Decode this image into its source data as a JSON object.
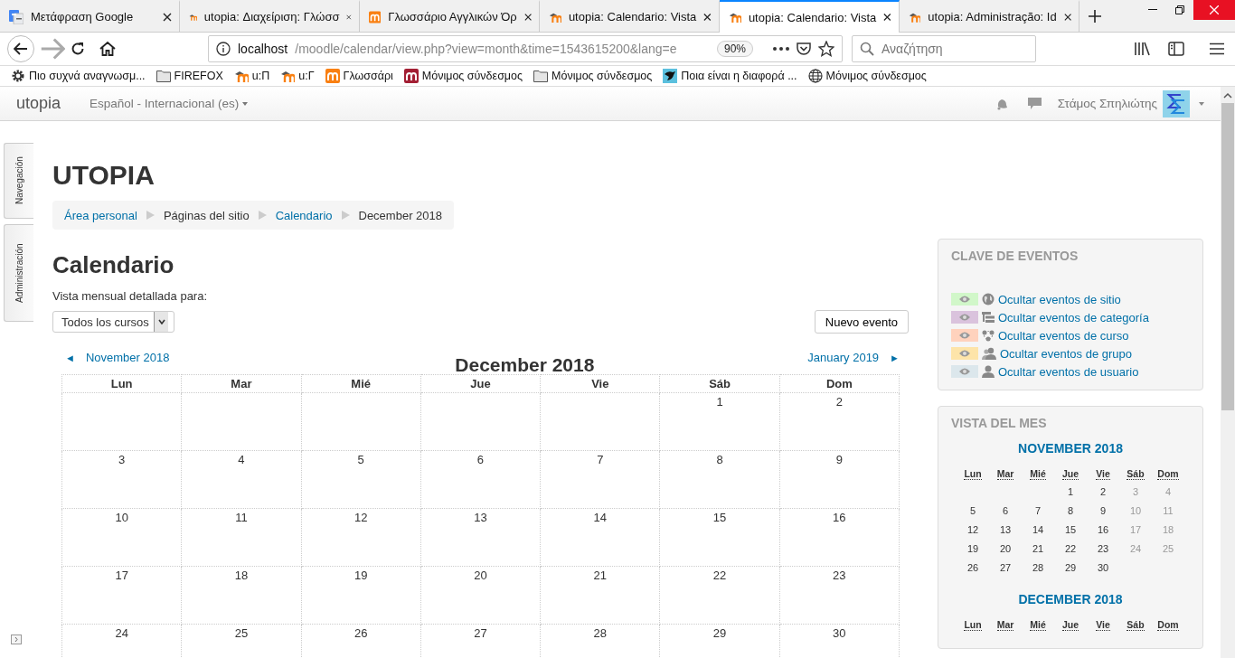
{
  "browser": {
    "tabs": [
      {
        "title": "Μετάφραση Google",
        "kind": "google",
        "selected": false
      },
      {
        "title": "utopia: Διαχείριση: Γλώσσ",
        "kind": "moodle",
        "selected": false
      },
      {
        "title": "Γλωσσάριο Αγγλικών Όρ",
        "kind": "moodle-orange",
        "selected": false
      },
      {
        "title": "utopia: Calendario: Vista",
        "kind": "moodle",
        "selected": false
      },
      {
        "title": "utopia: Calendario: Vista",
        "kind": "moodle",
        "selected": true
      },
      {
        "title": "utopia: Administração: Id",
        "kind": "moodle",
        "selected": false
      }
    ],
    "url_host": "localhost",
    "url_path": "/moodle/calendar/view.php?view=month&time=1543615200&lang=e",
    "zoom": "90%",
    "search": {
      "placeholder": "Αναζήτηση"
    },
    "bookmarks": [
      {
        "label": "Πιο συχνά αναγνωσμ...",
        "kind": "gear"
      },
      {
        "label": "FIREFOX",
        "kind": "folder"
      },
      {
        "label": "u:Π",
        "kind": "moodle"
      },
      {
        "label": "u:Γ",
        "kind": "moodle"
      },
      {
        "label": "Γλωσσάρι",
        "kind": "moodle-orange"
      },
      {
        "label": "Μόνιμος σύνδεσμος",
        "kind": "moodle-red"
      },
      {
        "label": "Μόνιμος σύνδεσμος",
        "kind": "folder"
      },
      {
        "label": "Ποια είναι η διαφορά ...",
        "kind": "bird"
      },
      {
        "label": "Μόνιμος σύνδεσμος",
        "kind": "globe"
      }
    ]
  },
  "navbar": {
    "brand": "utopia",
    "language": "Español - Internacional (es)",
    "user": "Στάμος Σπηλιώτης"
  },
  "dock": [
    "Navegación",
    "Administración"
  ],
  "site_title": "UTOPIA",
  "breadcrumb": [
    {
      "label": "Área personal",
      "link": true
    },
    {
      "label": "Páginas del sitio",
      "link": false
    },
    {
      "label": "Calendario",
      "link": true
    },
    {
      "label": "December 2018",
      "link": false
    }
  ],
  "calendar": {
    "heading": "Calendario",
    "filter_label": "Vista mensual detallada para:",
    "course_select": "Todos los cursos",
    "new_event": "Nuevo evento",
    "prev": "November 2018",
    "next": "January 2019",
    "prev_arrow": "◄",
    "next_arrow": "►",
    "month": "December 2018",
    "weekdays": [
      "Lun",
      "Mar",
      "Mié",
      "Jue",
      "Vie",
      "Sáb",
      "Dom"
    ],
    "weeks": [
      [
        {
          "kind": "blank"
        },
        {
          "kind": "blank"
        },
        {
          "kind": "blank"
        },
        {
          "kind": "blank"
        },
        {
          "kind": "blank"
        },
        {
          "kind": "day",
          "label": "1"
        },
        {
          "kind": "day",
          "label": "2"
        }
      ],
      [
        {
          "kind": "day",
          "label": "3"
        },
        {
          "kind": "day",
          "label": "4"
        },
        {
          "kind": "day",
          "label": "5"
        },
        {
          "kind": "day",
          "label": "6"
        },
        {
          "kind": "day",
          "label": "7"
        },
        {
          "kind": "day",
          "label": "8"
        },
        {
          "kind": "day",
          "label": "9"
        }
      ],
      [
        {
          "kind": "day",
          "label": "10"
        },
        {
          "kind": "day",
          "label": "11"
        },
        {
          "kind": "day",
          "label": "12"
        },
        {
          "kind": "day",
          "label": "13"
        },
        {
          "kind": "day",
          "label": "14"
        },
        {
          "kind": "day",
          "label": "15"
        },
        {
          "kind": "day",
          "label": "16"
        }
      ],
      [
        {
          "kind": "day",
          "label": "17"
        },
        {
          "kind": "day",
          "label": "18"
        },
        {
          "kind": "day",
          "label": "19"
        },
        {
          "kind": "day",
          "label": "20"
        },
        {
          "kind": "day",
          "label": "21"
        },
        {
          "kind": "day",
          "label": "22"
        },
        {
          "kind": "day",
          "label": "23"
        }
      ],
      [
        {
          "kind": "day",
          "label": "24"
        },
        {
          "kind": "day",
          "label": "25"
        },
        {
          "kind": "day",
          "label": "26"
        },
        {
          "kind": "day",
          "label": "27"
        },
        {
          "kind": "day",
          "label": "28"
        },
        {
          "kind": "day",
          "label": "29"
        },
        {
          "kind": "day",
          "label": "30"
        }
      ]
    ]
  },
  "event_key": {
    "title": "CLAVE DE EVENTOS",
    "items": [
      {
        "label": "Ocultar eventos de sitio",
        "color": "#d1f7c9",
        "kind": "site"
      },
      {
        "label": "Ocultar eventos de categoría",
        "color": "#dac3dd",
        "kind": "category"
      },
      {
        "label": "Ocultar eventos de curso",
        "color": "#ffd2bd",
        "kind": "course"
      },
      {
        "label": "Ocultar eventos de grupo",
        "color": "#fde4a9",
        "kind": "group"
      },
      {
        "label": "Ocultar eventos de usuario",
        "color": "#dce7ec",
        "kind": "user"
      }
    ]
  },
  "month_view": {
    "title": "VISTA DEL MES",
    "months": [
      {
        "title": "NOVEMBER 2018",
        "weekdays": [
          "Lun",
          "Mar",
          "Mié",
          "Jue",
          "Vie",
          "Sáb",
          "Dom"
        ],
        "weeks": [
          [
            {
              "kind": "blank"
            },
            {
              "kind": "blank"
            },
            {
              "kind": "blank"
            },
            {
              "kind": "day",
              "label": "1",
              "weekend": false
            },
            {
              "kind": "day",
              "label": "2",
              "weekend": false
            },
            {
              "kind": "day",
              "label": "3",
              "weekend": true
            },
            {
              "kind": "day",
              "label": "4",
              "weekend": true
            }
          ],
          [
            {
              "kind": "day",
              "label": "5",
              "weekend": false
            },
            {
              "kind": "day",
              "label": "6",
              "weekend": false
            },
            {
              "kind": "day",
              "label": "7",
              "weekend": false
            },
            {
              "kind": "day",
              "label": "8",
              "weekend": false
            },
            {
              "kind": "day",
              "label": "9",
              "weekend": false
            },
            {
              "kind": "day",
              "label": "10",
              "weekend": true
            },
            {
              "kind": "day",
              "label": "11",
              "weekend": true
            }
          ],
          [
            {
              "kind": "day",
              "label": "12",
              "weekend": false
            },
            {
              "kind": "day",
              "label": "13",
              "weekend": false
            },
            {
              "kind": "day",
              "label": "14",
              "weekend": false
            },
            {
              "kind": "day",
              "label": "15",
              "weekend": false
            },
            {
              "kind": "day",
              "label": "16",
              "weekend": false
            },
            {
              "kind": "day",
              "label": "17",
              "weekend": true
            },
            {
              "kind": "day",
              "label": "18",
              "weekend": true
            }
          ],
          [
            {
              "kind": "day",
              "label": "19",
              "weekend": false
            },
            {
              "kind": "day",
              "label": "20",
              "weekend": false
            },
            {
              "kind": "day",
              "label": "21",
              "weekend": false
            },
            {
              "kind": "day",
              "label": "22",
              "weekend": false
            },
            {
              "kind": "day",
              "label": "23",
              "weekend": false
            },
            {
              "kind": "day",
              "label": "24",
              "weekend": true
            },
            {
              "kind": "day",
              "label": "25",
              "weekend": true
            }
          ],
          [
            {
              "kind": "day",
              "label": "26",
              "weekend": false
            },
            {
              "kind": "day",
              "label": "27",
              "weekend": false
            },
            {
              "kind": "day",
              "label": "28",
              "weekend": false
            },
            {
              "kind": "day",
              "label": "29",
              "weekend": false
            },
            {
              "kind": "day",
              "label": "30",
              "weekend": false
            },
            {
              "kind": "blank"
            },
            {
              "kind": "blank"
            }
          ]
        ]
      },
      {
        "title": "DECEMBER 2018",
        "weekdays": [
          "Lun",
          "Mar",
          "Mié",
          "Jue",
          "Vie",
          "Sáb",
          "Dom"
        ]
      }
    ]
  }
}
